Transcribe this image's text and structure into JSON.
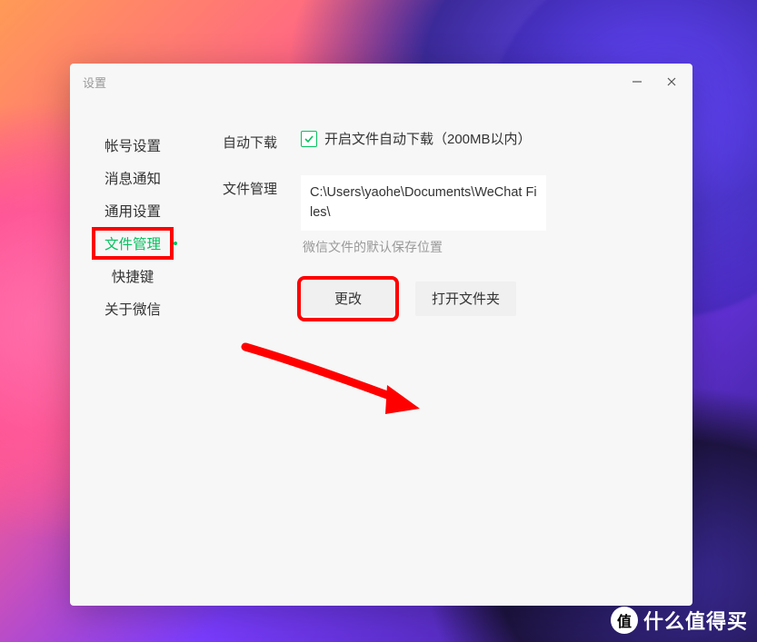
{
  "window": {
    "title": "设置"
  },
  "sidebar": {
    "items": [
      {
        "label": "帐号设置",
        "active": false
      },
      {
        "label": "消息通知",
        "active": false
      },
      {
        "label": "通用设置",
        "active": false
      },
      {
        "label": "文件管理",
        "active": true
      },
      {
        "label": "快捷键",
        "active": false
      },
      {
        "label": "关于微信",
        "active": false
      }
    ]
  },
  "content": {
    "auto_download": {
      "label": "自动下载",
      "checkbox_label": "开启文件自动下载（200MB以内）",
      "checked": true
    },
    "file_mgmt": {
      "label": "文件管理",
      "path": "C:\\Users\\yaohe\\Documents\\WeChat Files\\",
      "hint": "微信文件的默认保存位置",
      "change_btn": "更改",
      "open_btn": "打开文件夹"
    }
  },
  "watermark": {
    "badge": "值",
    "text": "什么值得买"
  }
}
